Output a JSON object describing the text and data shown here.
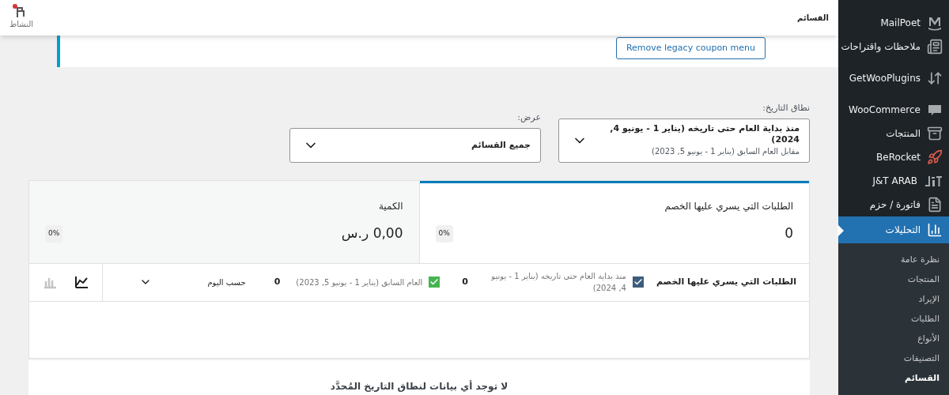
{
  "header": {
    "title": "القسائم",
    "activity": {
      "label": "النشاط",
      "unread": true
    }
  },
  "notice": {
    "button": "Remove legacy coupon menu"
  },
  "filters": [
    {
      "label": "نطاق التاريخ:",
      "value": "منذ بداية العام حتى تاريخه (يناير 1 - يونيو 4, 2024)",
      "sub": "مقابل العام السابق (يناير 1 - يونيو 5, 2023)"
    },
    {
      "label": "عرض:",
      "value": "جميع القسائم"
    }
  ],
  "summary": [
    {
      "label": "الطلبات التي يسري عليها الخصم",
      "value": "0",
      "delta": "0%",
      "selected": true
    },
    {
      "label": "الكمية",
      "value": "0,00 ر.س",
      "delta": "0%",
      "selected": false
    }
  ],
  "chart_header": {
    "title": "الطلبات التي يسري عليها الخصم",
    "legend": [
      {
        "label": "منذ بداية العام حتى تاريخه (يناير 1 - يونيو 4, 2024)",
        "value": "0",
        "checked": true,
        "color": "#3c5c7c"
      },
      {
        "label": "العام السابق (يناير 1 - يونيو 5, 2023)",
        "value": "0",
        "checked": true,
        "color": "#46b450"
      }
    ],
    "interval": "حسب اليوم",
    "chart_types": [
      {
        "kind": "line",
        "selected": true
      },
      {
        "kind": "bar",
        "selected": false
      }
    ]
  },
  "empty_message": "لا توجد أي بيانات لنطاق التاريخ المُحدَّد",
  "sidebar": {
    "items": [
      {
        "label": "MailPoet",
        "kind": "mailpoet",
        "selected": false,
        "gap": false
      },
      {
        "label": "ملاحظات واقتراحات",
        "kind": "feedback",
        "selected": false,
        "gap": false
      },
      {
        "label": "GetWooPlugins",
        "kind": "plugins",
        "selected": false,
        "gap": true
      },
      {
        "label": "WooCommerce",
        "kind": "woo",
        "selected": false,
        "gap": true
      },
      {
        "label": "المنتجات",
        "kind": "archive",
        "selected": false,
        "gap": false
      },
      {
        "label": "BeRocket",
        "kind": "rocket",
        "selected": false,
        "gap": false
      },
      {
        "label": "J&T ARAB",
        "kind": "jt",
        "selected": false,
        "gap": false
      },
      {
        "label": "فاتورة / حزم",
        "kind": "doc",
        "selected": false,
        "gap": false
      },
      {
        "label": "التحليلات",
        "kind": "chart",
        "selected": true,
        "gap": false
      }
    ],
    "submenu": [
      {
        "label": "نظرة عامة",
        "selected": false
      },
      {
        "label": "المنتجات",
        "selected": false
      },
      {
        "label": "الإيراد",
        "selected": false
      },
      {
        "label": "الطلبات",
        "selected": false
      },
      {
        "label": "الأنواع",
        "selected": false
      },
      {
        "label": "التصنيفات",
        "selected": false
      },
      {
        "label": "القسائم",
        "selected": true
      }
    ]
  }
}
